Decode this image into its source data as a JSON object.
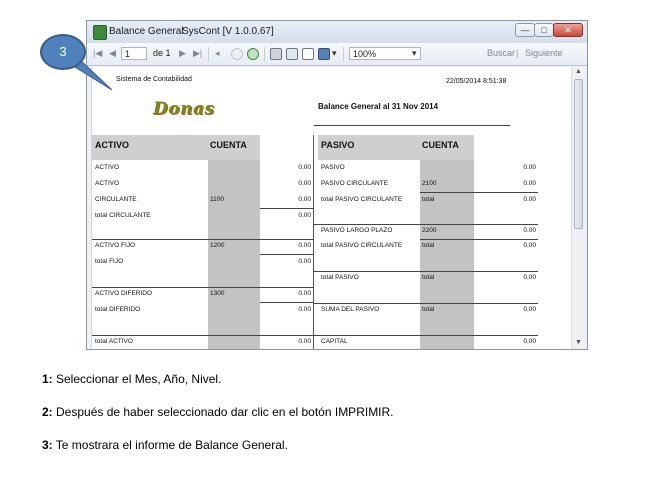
{
  "window": {
    "title": "Balance General",
    "app_title": "SysCont [V 1.0.0.67]",
    "controls": [
      "—",
      "□",
      "✕"
    ]
  },
  "toolbar": {
    "page_current": "1",
    "page_of": "de 1",
    "zoom": "100%",
    "search_label": "Buscar",
    "next_label": "Siguiente"
  },
  "report": {
    "company": "Sistema de Contabilidad",
    "datetime": "22/05/2014 8:51:38",
    "logo_text": "Donas",
    "title": "Balance General al 31  Nov  2014",
    "left": {
      "header": "ACTIVO",
      "header_col": "CUENTA",
      "rows": [
        {
          "label": "ACTIVO",
          "cuenta": "",
          "value": "0.00"
        },
        {
          "label": "ACTIVO",
          "cuenta": "",
          "value": "0.00"
        },
        {
          "label": "CIRCULANTE",
          "cuenta": "1100",
          "value": "0.00"
        },
        {
          "label": "total CIRCULANTE",
          "cuenta": "",
          "value": "0.00"
        },
        {
          "label": "ACTIVO FIJO",
          "cuenta": "1200",
          "value": "0.00"
        },
        {
          "label": "total FIJO",
          "cuenta": "",
          "value": "0.00"
        },
        {
          "label": "ACTIVO DIFERIDO",
          "cuenta": "1300",
          "value": "0.00"
        },
        {
          "label": "total DIFERIDO",
          "cuenta": "",
          "value": "0.00"
        },
        {
          "label": "total ACTIVO",
          "cuenta": "",
          "value": "0.00"
        }
      ]
    },
    "right": {
      "header": "PASIVO",
      "header_col": "CUENTA",
      "rows": [
        {
          "label": "PASIVO",
          "cuenta": "",
          "value": "0.00"
        },
        {
          "label": "PASIVO CIRCULANTE",
          "cuenta": "2100",
          "value": "0.00"
        },
        {
          "label": "total PASIVO CIRCULANTE",
          "cuenta": "total",
          "value": "0.00"
        },
        {
          "label": "PASIVO LARGO PLAZO",
          "cuenta": "2200",
          "value": "0.00"
        },
        {
          "label": "total PASIVO CIRCULANTE",
          "cuenta": "total",
          "value": "0.00"
        },
        {
          "label": "total PASIVO",
          "cuenta": "total",
          "value": "0.00"
        },
        {
          "label": "SUMA DEL PASIVO",
          "cuenta": "total",
          "value": "0.00"
        },
        {
          "label": "CAPITAL",
          "cuenta": "",
          "value": "0.00"
        }
      ]
    }
  },
  "callout": {
    "number": "3"
  },
  "instructions": [
    {
      "num": "1:",
      "text": " Seleccionar el Mes, Año, Nivel."
    },
    {
      "num": "2:",
      "text": " Después de haber seleccionado dar clic  en el botón IMPRIMIR."
    },
    {
      "num": "3:",
      "text": " Te mostrara el informe de Balance General."
    }
  ],
  "colors": {
    "accent": "#4f81bd",
    "header_gray": "#cfcfcf",
    "column_gray": "#c3c3c3",
    "logo": "#6e8f1f"
  }
}
